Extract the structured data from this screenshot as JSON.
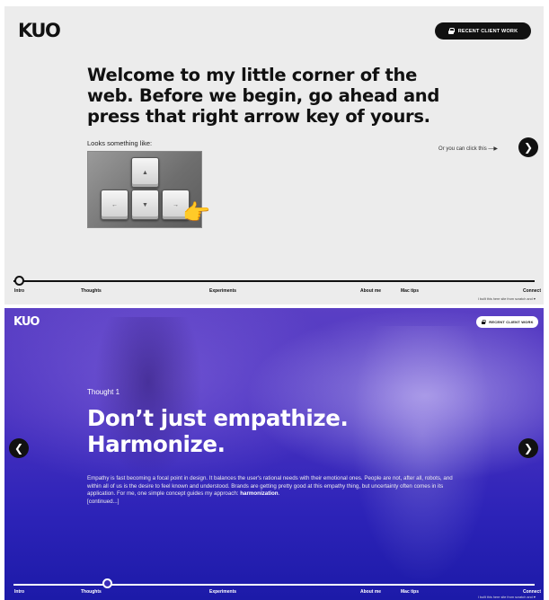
{
  "brand": {
    "logo": "KUO"
  },
  "header": {
    "client_button_label": "RECENT CLIENT WORK"
  },
  "intro": {
    "heading": "Welcome to my little corner of the web. Before we begin, go ahead and press that right arrow key of yours.",
    "looks_like": "Looks something like:",
    "click_hint": "Or you can click this —▶",
    "keys": {
      "up": "▲",
      "left": "←",
      "down": "▼",
      "right": "→"
    },
    "hand_emoji": "👉"
  },
  "icons": {
    "next": "❯",
    "prev": "❮",
    "lock": "lock-icon"
  },
  "timeline": {
    "items": [
      "Intro",
      "Thoughts",
      "Experiments",
      "About me",
      "Mac tips",
      "Connect"
    ],
    "footnote": "I built this here site from scratch and ♥"
  },
  "thought": {
    "label": "Thought 1",
    "title": "Don’t just empathize. Harmonize.",
    "body_text": "Empathy is fast becoming a focal point in design. It balances the user's rational needs with their emotional ones. People are not, after all, robots, and within all of us is the desire to feel known and understood. Brands are getting pretty good at this empathy thing, but uncertainty often comes in its application. For me, one simple concept guides my approach: ",
    "body_bold": "harmonization",
    "body_end": ".",
    "continued": "[continued...]"
  },
  "colors": {
    "top_bg": "#ececec",
    "ink": "#111111",
    "purple_top": "#5a3fc4",
    "purple_bottom": "#1c1aa8"
  }
}
